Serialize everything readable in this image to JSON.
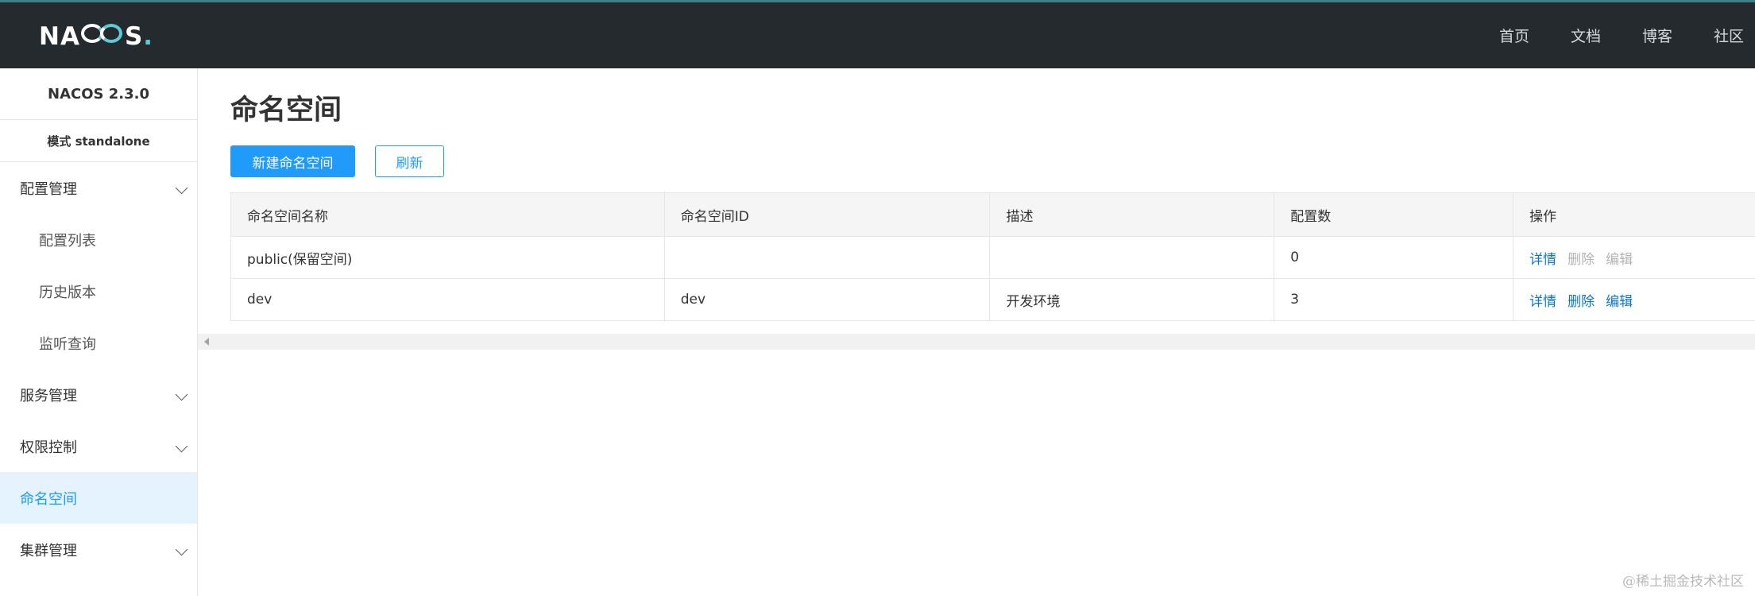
{
  "header": {
    "logo": {
      "left": "NA",
      "right": "S",
      "dot": "."
    },
    "nav": [
      "首页",
      "文档",
      "博客",
      "社区"
    ]
  },
  "sidebar": {
    "version": "NACOS 2.3.0",
    "mode": "模式 standalone",
    "items": [
      {
        "label": "配置管理",
        "type": "group"
      },
      {
        "label": "配置列表",
        "type": "sub"
      },
      {
        "label": "历史版本",
        "type": "sub"
      },
      {
        "label": "监听查询",
        "type": "sub"
      },
      {
        "label": "服务管理",
        "type": "group"
      },
      {
        "label": "权限控制",
        "type": "group"
      },
      {
        "label": "命名空间",
        "type": "active"
      },
      {
        "label": "集群管理",
        "type": "group"
      }
    ]
  },
  "main": {
    "title": "命名空间",
    "new_button": "新建命名空间",
    "refresh_button": "刷新",
    "table": {
      "headers": [
        "命名空间名称",
        "命名空间ID",
        "描述",
        "配置数",
        "操作"
      ],
      "rows": [
        {
          "name": "public(保留空间)",
          "id": "",
          "desc": "",
          "count": "0",
          "ops": [
            "详情",
            "删除",
            "编辑"
          ]
        },
        {
          "name": "dev",
          "id": "dev",
          "desc": "开发环境",
          "count": "3",
          "ops": [
            "详情",
            "删除",
            "编辑"
          ]
        }
      ]
    }
  },
  "watermark": "@稀土掘金技术社区",
  "colors": {
    "primary": "#209bfa",
    "link": "#0b75c9",
    "header_bg": "#252a2f",
    "active_bg": "#e4f3fd",
    "accent": "#5ccbd6"
  }
}
